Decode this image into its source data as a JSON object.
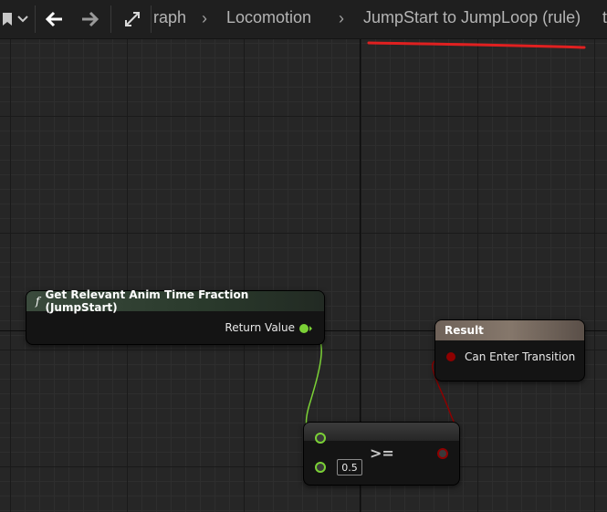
{
  "toolbar": {
    "breadcrumb": [
      {
        "label": "raph"
      },
      {
        "label": "Locomotion"
      },
      {
        "label": "JumpStart to JumpLoop (rule)"
      }
    ],
    "overflow_char": "t"
  },
  "nodes": {
    "get_time_fraction": {
      "title": "Get Relevant Anim Time Fraction (JumpStart)",
      "function_icon": "f",
      "output_pin": "Return Value"
    },
    "result": {
      "title": "Result",
      "input_pin": "Can Enter Transition"
    },
    "compare": {
      "operator": ">=",
      "input_value": "0.5"
    }
  },
  "colors": {
    "float_pin": "#7bd136",
    "bool_pin": "#8e0000",
    "result_header": "#6f6259",
    "function_header": "#2a3a2c",
    "annotation": "#e02020"
  },
  "icons": [
    "bookmark-icon",
    "chevron-down-icon",
    "back-arrow-icon",
    "forward-arrow-icon",
    "expand-icon"
  ]
}
